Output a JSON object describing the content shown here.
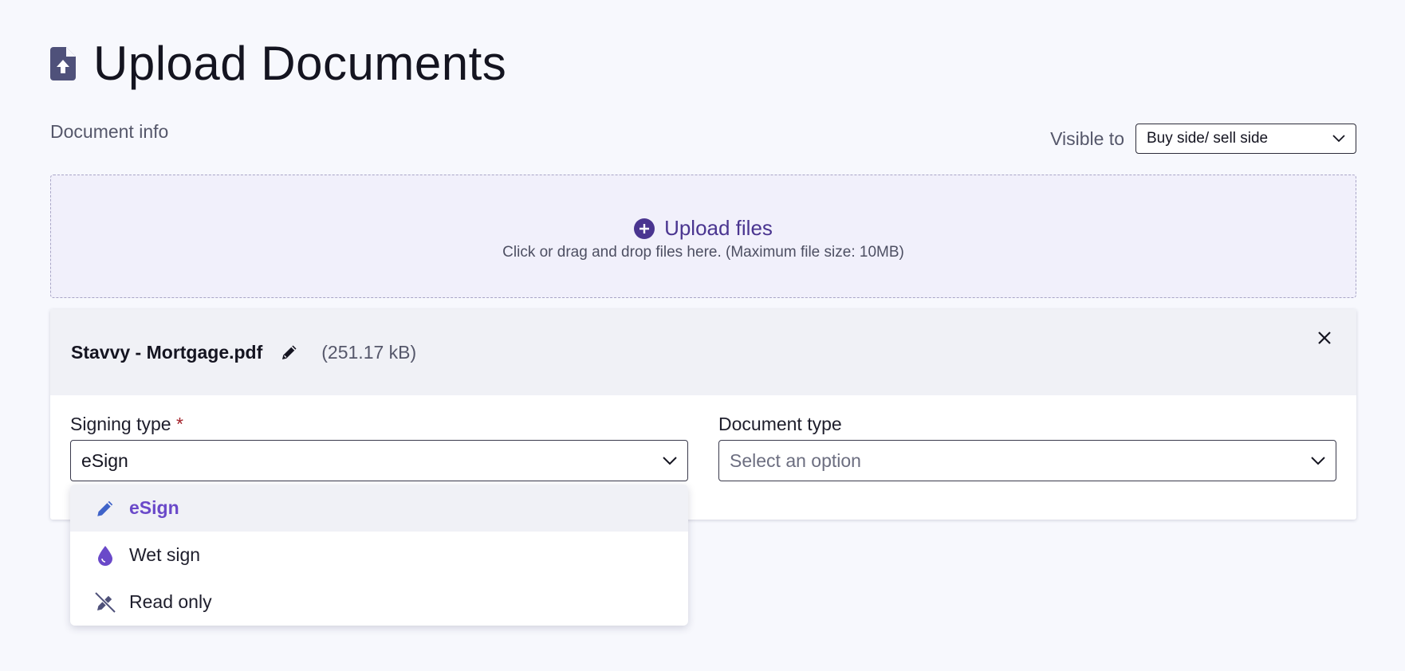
{
  "header": {
    "title": "Upload Documents",
    "icon": "file-upload-icon"
  },
  "document_info": {
    "label": "Document info",
    "visible_to_label": "Visible to",
    "visible_to_value": "Buy side/ sell side"
  },
  "dropzone": {
    "title": "Upload files",
    "hint": "Click or drag and drop files here. (Maximum file size: 10MB)",
    "icon": "plus-circle-icon"
  },
  "file": {
    "name": "Stavvy - Mortgage.pdf",
    "size": "(251.17 kB)"
  },
  "signing_type": {
    "label": "Signing type",
    "required_mark": "*",
    "value": "eSign",
    "options": [
      {
        "label": "eSign",
        "icon": "pen-icon",
        "selected": true
      },
      {
        "label": "Wet sign",
        "icon": "droplet-icon",
        "selected": false
      },
      {
        "label": "Read only",
        "icon": "pen-slash-icon",
        "selected": false
      }
    ]
  },
  "document_type": {
    "label": "Document type",
    "placeholder": "Select an option"
  },
  "colors": {
    "accent": "#6a49c9",
    "brand_dark": "#4a3590",
    "icon_slate": "#4f517a",
    "background": "#f7f8fd"
  }
}
